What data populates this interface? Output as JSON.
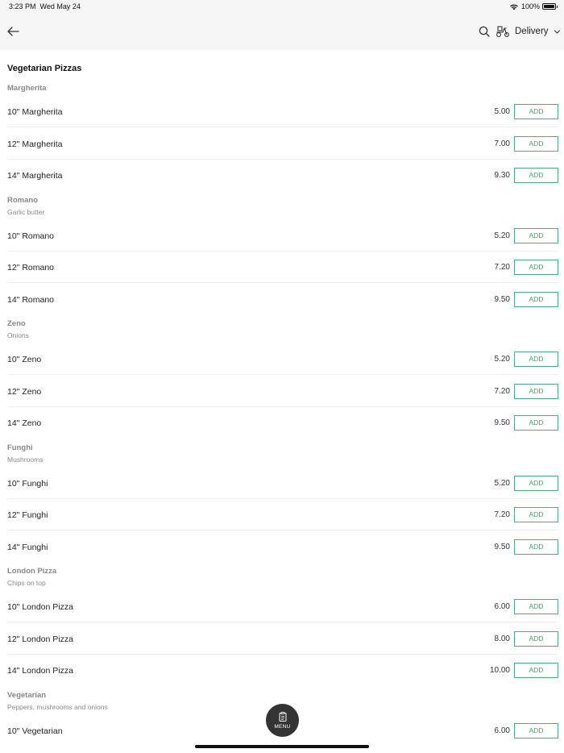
{
  "status_bar": {
    "time": "3:23 PM",
    "date": "Wed May 24",
    "battery": "100%"
  },
  "header": {
    "back_icon": "arrow-left-icon",
    "search_icon": "search-icon",
    "delivery_icon": "scooter-icon",
    "delivery_label": "Delivery",
    "chevron_icon": "chevron-down-icon"
  },
  "category": {
    "title": "Vegetarian Pizzas",
    "groups": [
      {
        "name": "Margherita",
        "description": "",
        "items": [
          {
            "name": "10\" Margherita",
            "price": "5.00",
            "add": "ADD"
          },
          {
            "name": "12\" Margherita",
            "price": "7.00",
            "add": "ADD"
          },
          {
            "name": "14\" Margherita",
            "price": "9.30",
            "add": "ADD"
          }
        ]
      },
      {
        "name": "Romano",
        "description": "Garlic butter",
        "items": [
          {
            "name": "10\" Romano",
            "price": "5.20",
            "add": "ADD"
          },
          {
            "name": "12\" Romano",
            "price": "7.20",
            "add": "ADD"
          },
          {
            "name": "14\" Romano",
            "price": "9.50",
            "add": "ADD"
          }
        ]
      },
      {
        "name": "Zeno",
        "description": "Onions",
        "items": [
          {
            "name": "10\" Zeno",
            "price": "5.20",
            "add": "ADD"
          },
          {
            "name": "12\" Zeno",
            "price": "7.20",
            "add": "ADD"
          },
          {
            "name": "14\" Zeno",
            "price": "9.50",
            "add": "ADD"
          }
        ]
      },
      {
        "name": "Funghi",
        "description": "Mushrooms",
        "items": [
          {
            "name": "10\" Funghi",
            "price": "5.20",
            "add": "ADD"
          },
          {
            "name": "12\" Funghi",
            "price": "7.20",
            "add": "ADD"
          },
          {
            "name": "14\" Funghi",
            "price": "9.50",
            "add": "ADD"
          }
        ]
      },
      {
        "name": "London Pizza",
        "description": "Chips on top",
        "items": [
          {
            "name": "10\" London Pizza",
            "price": "6.00",
            "add": "ADD"
          },
          {
            "name": "12\" London Pizza",
            "price": "8.00",
            "add": "ADD"
          },
          {
            "name": "14\" London Pizza",
            "price": "10.00",
            "add": "ADD"
          }
        ]
      },
      {
        "name": "Vegetarian",
        "description": "Peppers, mushrooms and onions",
        "items": [
          {
            "name": "10\" Vegetarian",
            "price": "6.00",
            "add": "ADD"
          }
        ]
      }
    ]
  },
  "menu_fab": {
    "icon": "clipboard-icon",
    "label": "MENU"
  },
  "colors": {
    "accent_green": "#3ea565",
    "header_bg": "#f5f5f5",
    "fab_bg": "#333333"
  }
}
